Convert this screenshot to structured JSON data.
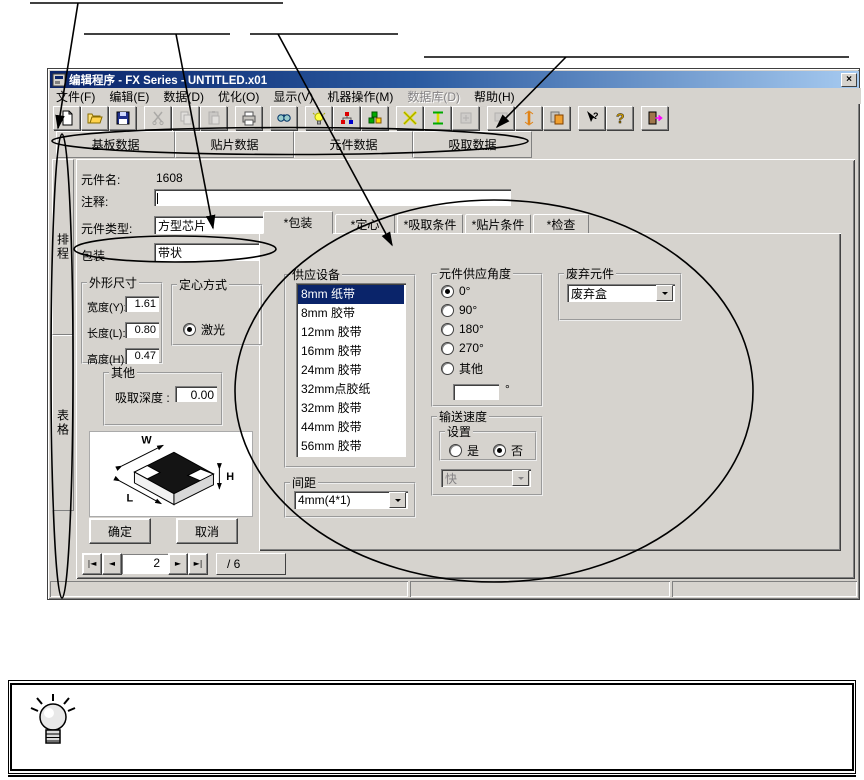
{
  "window": {
    "title": "编辑程序 - FX Series - UNTITLED.x01",
    "close_label": "×"
  },
  "menu": {
    "items": [
      {
        "label": "文件(F)",
        "disabled": false
      },
      {
        "label": "编辑(E)",
        "disabled": false
      },
      {
        "label": "数据(D)",
        "disabled": false
      },
      {
        "label": "优化(O)",
        "disabled": false
      },
      {
        "label": "显示(V)",
        "disabled": false
      },
      {
        "label": "机器操作(M)",
        "disabled": false
      },
      {
        "label": "数据库(D)",
        "disabled": true
      },
      {
        "label": "帮助(H)",
        "disabled": false
      }
    ]
  },
  "toolbar": {
    "buttons": [
      {
        "name": "new-document",
        "disabled": false,
        "gap": false
      },
      {
        "name": "open-file",
        "disabled": false,
        "gap": false
      },
      {
        "name": "save",
        "disabled": false,
        "gap": false
      },
      {
        "name": "cut",
        "disabled": true,
        "gap": true
      },
      {
        "name": "copy",
        "disabled": true,
        "gap": false
      },
      {
        "name": "paste",
        "disabled": true,
        "gap": false
      },
      {
        "name": "print",
        "disabled": false,
        "gap": true
      },
      {
        "name": "find",
        "disabled": false,
        "gap": true
      },
      {
        "name": "optimize",
        "disabled": false,
        "gap": true
      },
      {
        "name": "balance",
        "disabled": false,
        "gap": false
      },
      {
        "name": "parts",
        "disabled": false,
        "gap": false
      },
      {
        "name": "exchange-x",
        "disabled": false,
        "gap": true
      },
      {
        "name": "exchange-i",
        "disabled": false,
        "gap": false
      },
      {
        "name": "apply",
        "disabled": true,
        "gap": false
      },
      {
        "name": "teach",
        "disabled": true,
        "gap": true
      },
      {
        "name": "height-adjust",
        "disabled": false,
        "gap": false
      },
      {
        "name": "copy-stack",
        "disabled": false,
        "gap": false
      },
      {
        "name": "context-help",
        "disabled": false,
        "gap": true
      },
      {
        "name": "help",
        "disabled": false,
        "gap": false
      },
      {
        "name": "exit",
        "disabled": false,
        "gap": true
      }
    ]
  },
  "tabs": {
    "items": [
      "基板数据",
      "贴片数据",
      "元件数据",
      "吸取数据"
    ],
    "active_index": 2
  },
  "side_tabs": {
    "items": [
      "排程",
      "表格"
    ]
  },
  "form": {
    "part_name_label": "元件名:",
    "part_name_value": "1608",
    "comment_label": "注释:",
    "comment_value": "",
    "part_type_label": "元件类型:",
    "part_type_value": "方型芯片",
    "package_label": "包装",
    "package_value": "带状"
  },
  "inner_tabs": {
    "items": [
      "*包装",
      "*定心",
      "*吸取条件",
      "*贴片条件",
      "*检查"
    ],
    "active_index": 0
  },
  "package_tab": {
    "supply_device": {
      "title": "供应设备",
      "items": [
        "8mm 纸带",
        "8mm 胶带",
        "12mm 胶带",
        "16mm 胶带",
        "24mm 胶带",
        "32mm点胶纸",
        "32mm 胶带",
        "44mm 胶带",
        "56mm 胶带"
      ],
      "selected_index": 0
    },
    "pitch": {
      "title": "间距",
      "value": "4mm(4*1)"
    },
    "supply_angle": {
      "title": "元件供应角度",
      "options": [
        "0°",
        "90°",
        "180°",
        "270°",
        "其他"
      ],
      "selected_index": 0,
      "other_value": "",
      "unit": "°"
    },
    "discard": {
      "title": "废弃元件",
      "value": "废弃盒"
    },
    "transport": {
      "title": "输送速度",
      "setting_title": "设置",
      "options": [
        "是",
        "否"
      ],
      "selected_index": 1,
      "speed_value": "快"
    }
  },
  "left_panel": {
    "dimensions": {
      "title": "外形尺寸",
      "fields": [
        {
          "label": "宽度(Y):",
          "value": "1.61"
        },
        {
          "label": "长度(L):",
          "value": "0.80"
        },
        {
          "label": "高度(H):",
          "value": "0.47"
        }
      ]
    },
    "centering": {
      "title": "定心方式",
      "option": "激光"
    },
    "other": {
      "title": "其他",
      "label": "吸取深度 :",
      "value": "0.00"
    },
    "diagram_labels": {
      "w": "W",
      "h": "H",
      "l": "L"
    }
  },
  "actions": {
    "ok": "确定",
    "cancel": "取消"
  },
  "record_nav": {
    "first": "|◄",
    "prev": "◄",
    "next": "►",
    "last": "►|",
    "value": "2",
    "total": "/ 6"
  },
  "status_bar": {
    "panels": [
      "",
      "",
      ""
    ]
  }
}
